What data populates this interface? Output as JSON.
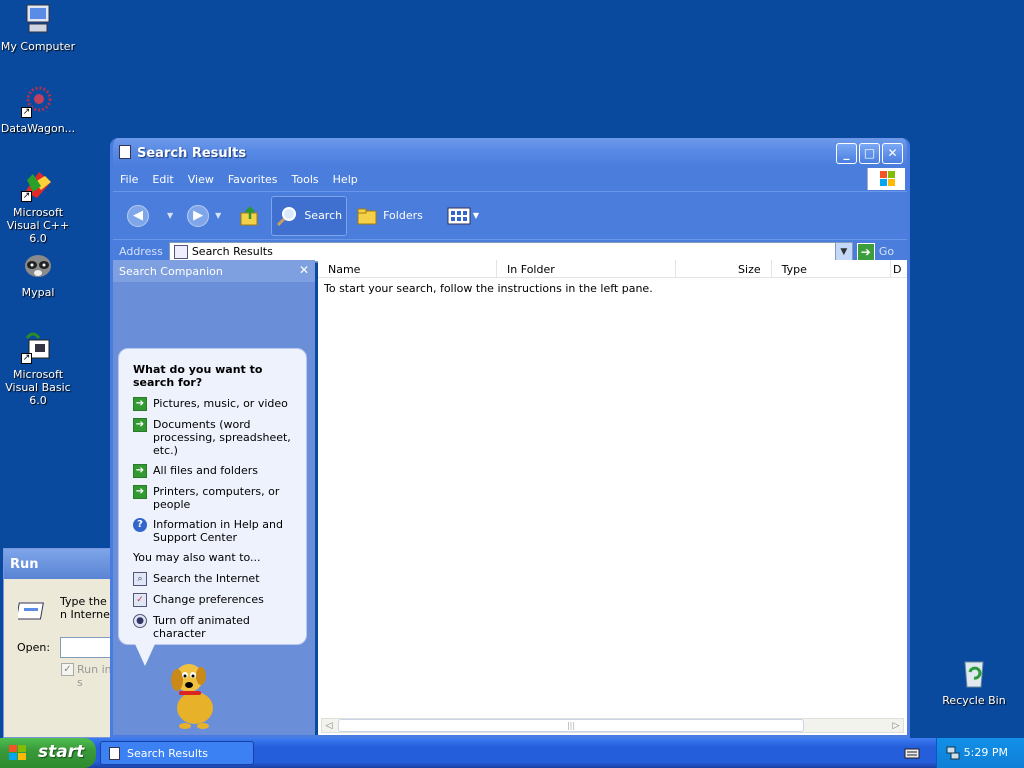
{
  "desktop": {
    "icons": [
      {
        "label": "My Computer"
      },
      {
        "label": "DataWagon..."
      },
      {
        "label": "Microsoft Visual C++ 6.0"
      },
      {
        "label": "Mypal"
      },
      {
        "label": "Microsoft Visual Basic 6.0"
      },
      {
        "label": "Recycle Bin"
      }
    ]
  },
  "run_dialog": {
    "title": "Run",
    "desc": "Type the n Internet re",
    "open_label": "Open:",
    "checkbox_label": "Run in s"
  },
  "window": {
    "title": "Search Results",
    "menu": [
      "File",
      "Edit",
      "View",
      "Favorites",
      "Tools",
      "Help"
    ],
    "toolbar": {
      "search_label": "Search",
      "folders_label": "Folders"
    },
    "address": {
      "label": "Address",
      "value": "Search Results",
      "go_label": "Go"
    },
    "companion": {
      "header": "Search Companion",
      "question": "What do you want to search for?",
      "options": [
        "Pictures, music, or video",
        "Documents (word processing, spreadsheet, etc.)",
        "All files and folders",
        "Printers, computers, or people",
        "Information in Help and Support Center"
      ],
      "also_label": "You may also want to...",
      "also_options": [
        "Search the Internet",
        "Change preferences",
        "Turn off animated character"
      ]
    },
    "results": {
      "columns": [
        "Name",
        "In Folder",
        "Size",
        "Type",
        "D"
      ],
      "empty_message": "To start your search, follow the instructions in the left pane."
    }
  },
  "taskbar": {
    "start_label": "start",
    "task_label": "Search Results",
    "clock": "5:29 PM"
  },
  "colors": {
    "desktop_bg": "#0a4a9e",
    "titlebar": "#4a7ddc",
    "start_green": "#3a9a3a",
    "taskbar_blue": "#245edb"
  }
}
